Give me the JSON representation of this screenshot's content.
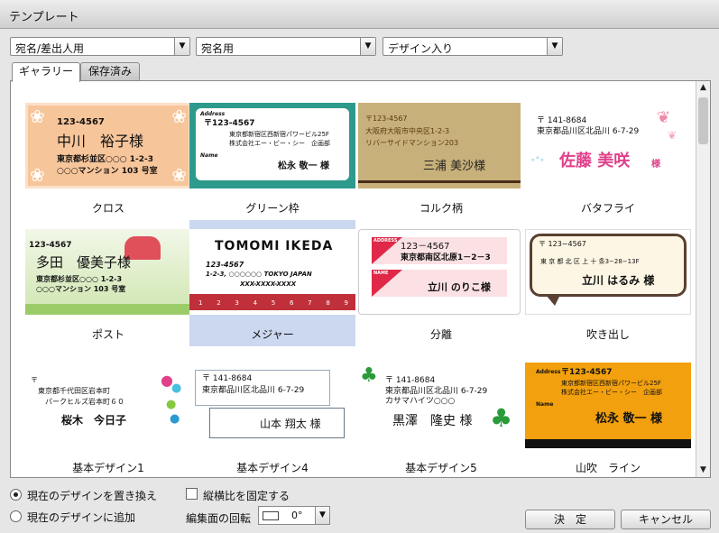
{
  "window": {
    "title": "テンプレート"
  },
  "filters": [
    {
      "value": "宛名/差出人用"
    },
    {
      "value": "宛名用"
    },
    {
      "value": "デザイン入り"
    }
  ],
  "tabs": [
    {
      "label": "ギャラリー",
      "active": true
    },
    {
      "label": "保存済み",
      "active": false
    }
  ],
  "gallery": {
    "items": [
      {
        "caption": "クロス",
        "lines": [
          "123-4567",
          "中川　裕子様",
          "東京都杉並区○○○ 1-2-3",
          "○○○マンション 103 号室"
        ]
      },
      {
        "caption": "グリーン枠",
        "lines": [
          "Address",
          "〒123-4567",
          "東京都新宿区西新宿パワービル25F",
          "株式会社エー・ビー・シー　企画部",
          "Name",
          "松永 敬一 様"
        ]
      },
      {
        "caption": "コルク柄",
        "lines": [
          "〒123-4567",
          "大阪府大阪市中央区1-2-3",
          "リバーサイドマンション203",
          "三浦 美沙様"
        ]
      },
      {
        "caption": "バタフライ",
        "lines": [
          "〒 141-8684",
          "東京都品川区北品川 6-7-29",
          "佐藤 美咲",
          "様"
        ]
      },
      {
        "caption": "ポスト",
        "lines": [
          "123-4567",
          "多田　優美子様",
          "東京都杉並区○○○ 1-2-3",
          "○○○マンション 103 号室"
        ]
      },
      {
        "caption": "メジャー",
        "lines": [
          "TOMOMI IKEDA",
          "123-4567",
          "1-2-3, ○○○○○○ TOKYO JAPAN",
          "XXX-XXXX-XXXX"
        ],
        "ruler": [
          "1",
          "2",
          "3",
          "4",
          "5",
          "6",
          "7",
          "8",
          "9"
        ]
      },
      {
        "caption": "分離",
        "lines": [
          "ADDRESS",
          "123－4567",
          "東京都南区北原1－2－3",
          "NAME",
          "立川 のりこ様"
        ]
      },
      {
        "caption": "吹き出し",
        "lines": [
          "〒 123−4567",
          "東 京 都 北 区 上 十 条3−28−13F",
          "立川 はるみ 様"
        ]
      },
      {
        "caption": "基本デザイン1",
        "lines": [
          "〒",
          "東京都千代田区岩本町",
          "パークヒルズ岩本町６０",
          "桜木　今日子"
        ]
      },
      {
        "caption": "基本デザイン4",
        "lines": [
          "〒 141-8684",
          "東京都品川区北品川 6-7-29",
          "山本 翔太 様"
        ]
      },
      {
        "caption": "基本デザイン5",
        "lines": [
          "〒 141-8684",
          "東京都品川区北品川 6-7-29",
          "カサマハイツ○○○",
          "黒澤　隆史 様"
        ]
      },
      {
        "caption": "山吹　ライン",
        "lines": [
          "Address",
          "〒123-4567",
          "東京都新宿区西新宿パワービル25F",
          "株式会社エー・ビー・シー　企画部",
          "Name",
          "松永 敬一 様"
        ]
      }
    ]
  },
  "options": {
    "replace_label": "現在のデザインを置き換え",
    "add_label": "現在のデザインに追加",
    "lock_ratio_label": "縦横比を固定する",
    "rotation_label": "編集面の回転",
    "rotation_value": "0°"
  },
  "buttons": {
    "ok": "決　定",
    "cancel": "キャンセル"
  },
  "icons": {
    "dropdown": "chevron-down-icon",
    "scroll_up": "triangle-up-icon",
    "scroll_down": "triangle-down-icon",
    "rotation_preview": "card-outline-icon"
  }
}
